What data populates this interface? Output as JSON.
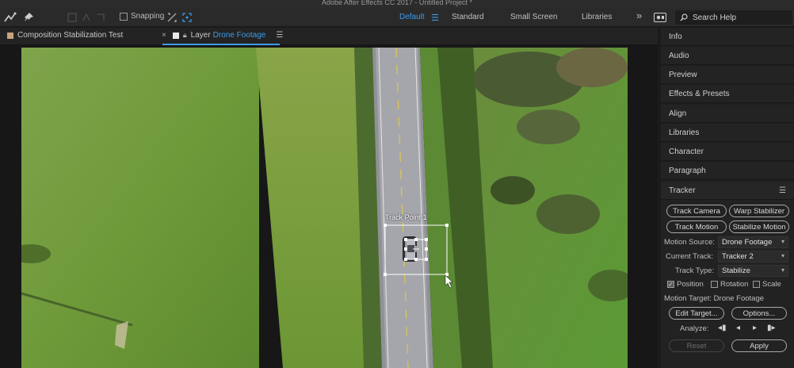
{
  "app_title": "Adobe After Effects CC 2017 - Untitled Project *",
  "toolbar": {
    "snapping_label": "Snapping",
    "workspaces": [
      "Default",
      "Standard",
      "Small Screen",
      "Libraries"
    ],
    "active_workspace": "Default",
    "overflow_glyph": "»",
    "search_placeholder": "Search Help"
  },
  "tabs": {
    "composition": "Composition Stabilization Test",
    "layer_prefix": "Layer",
    "layer_name": "Drone Footage"
  },
  "viewer": {
    "track_point_label": "Track Point 1"
  },
  "right_panels": [
    "Info",
    "Audio",
    "Preview",
    "Effects & Presets",
    "Align",
    "Libraries",
    "Character",
    "Paragraph"
  ],
  "tracker": {
    "title": "Tracker",
    "buttons": {
      "track_camera": "Track Camera",
      "warp_stabilizer": "Warp Stabilizer",
      "track_motion": "Track Motion",
      "stabilize_motion": "Stabilize Motion",
      "edit_target": "Edit Target...",
      "options": "Options...",
      "reset": "Reset",
      "apply": "Apply"
    },
    "motion_source_label": "Motion Source:",
    "motion_source_value": "Drone Footage",
    "current_track_label": "Current Track:",
    "current_track_value": "Tracker 2",
    "track_type_label": "Track Type:",
    "track_type_value": "Stabilize",
    "checks": {
      "position": "Position",
      "rotation": "Rotation",
      "scale": "Scale"
    },
    "position_checked": true,
    "rotation_checked": false,
    "scale_checked": false,
    "motion_target_text": "Motion Target: Drone Footage",
    "analyze_label": "Analyze:"
  },
  "colors": {
    "accent": "#3d9be9",
    "grass": "#6a9a35",
    "road": "#8c8e93"
  }
}
